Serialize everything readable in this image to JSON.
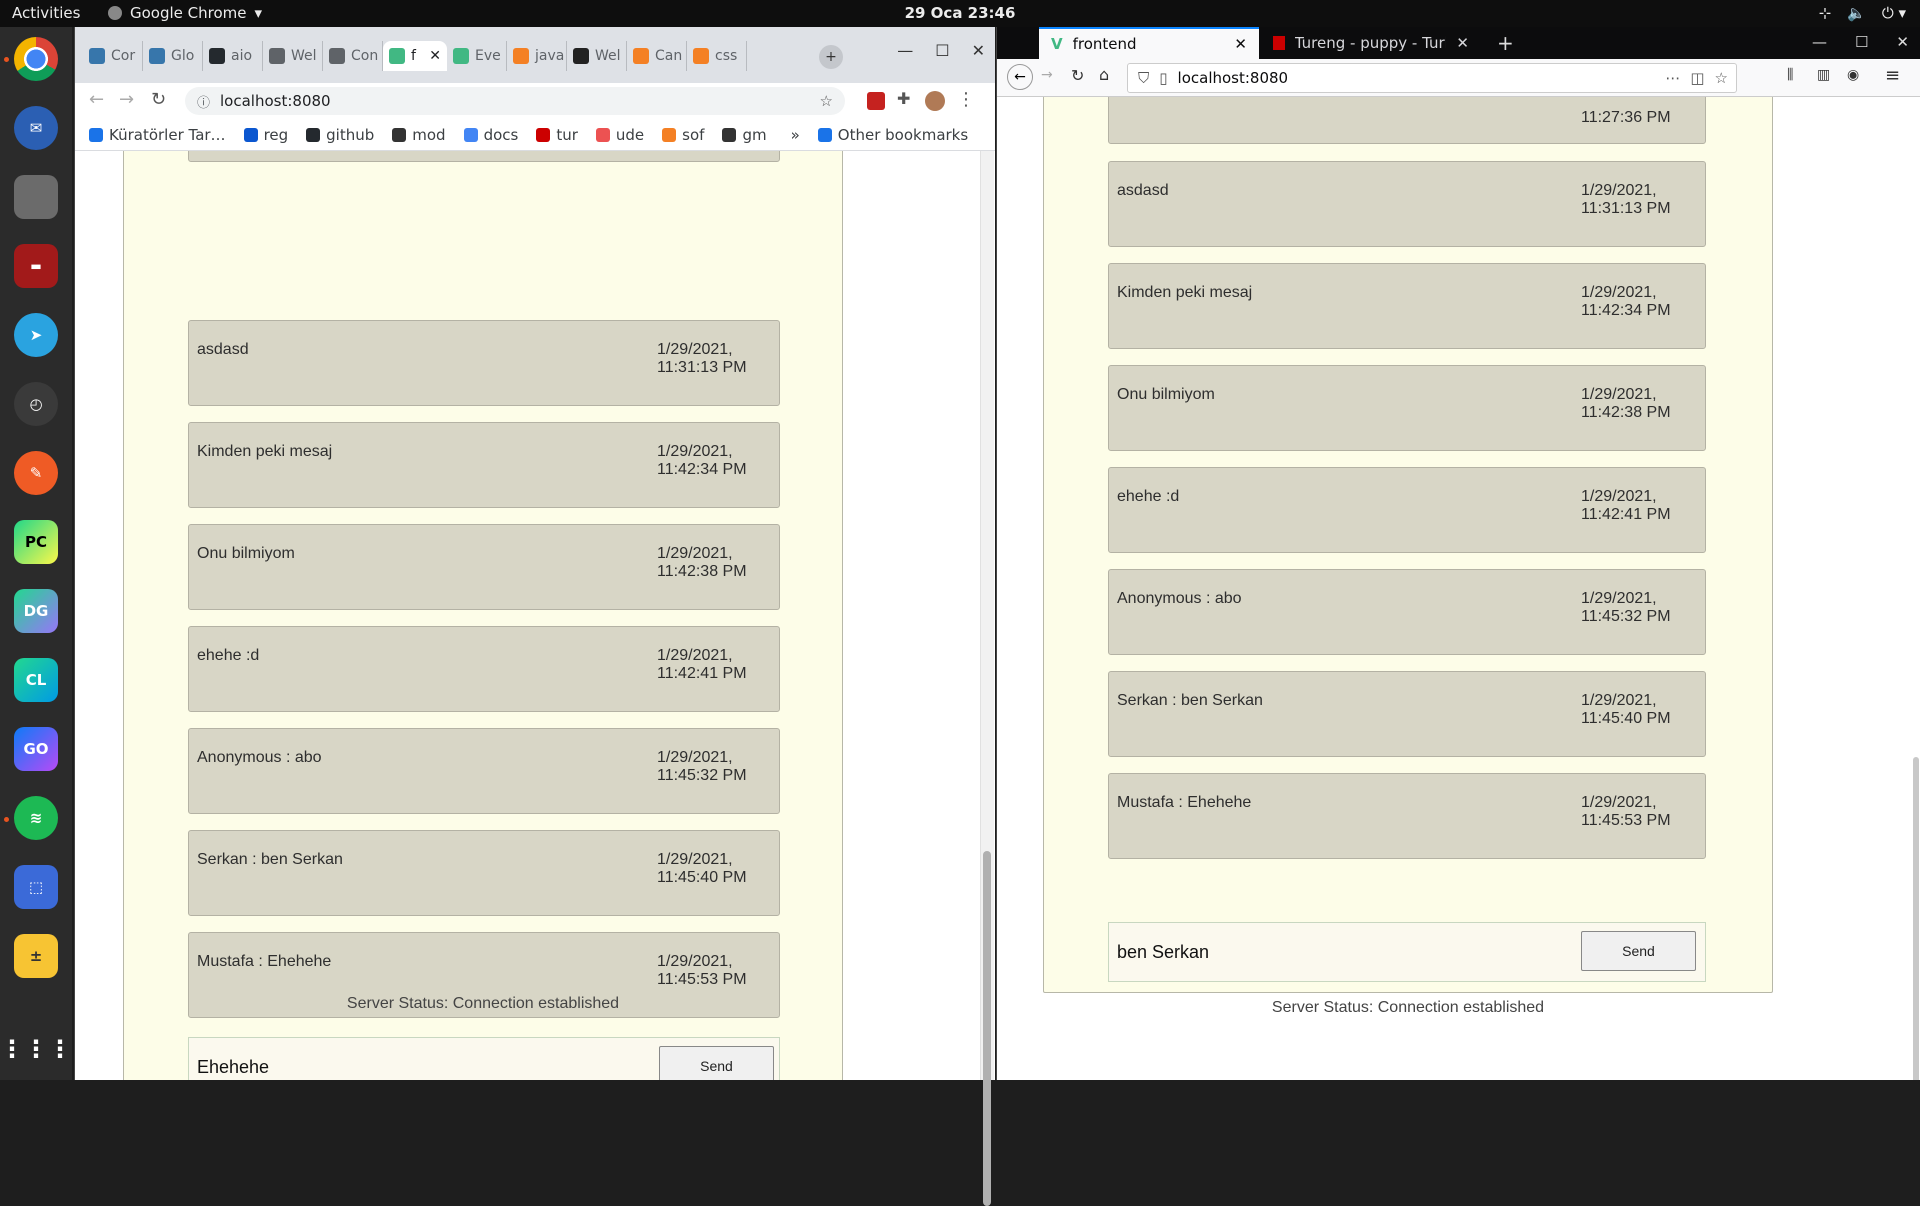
{
  "topbar": {
    "activities": "Activities",
    "app_name": "Google Chrome",
    "clock": "29 Oca  23:46"
  },
  "dock": {
    "items": [
      "chrome-icon",
      "thunderbird-icon",
      "files-icon",
      "terminal-icon",
      "telegram-icon",
      "clock-icon",
      "postman-icon",
      "PC",
      "DG",
      "CL",
      "GO",
      "spotify-icon",
      "screenshot-icon",
      "calculator-icon",
      "app-grid-icon"
    ]
  },
  "chrome": {
    "tabs": [
      {
        "label": "Cor",
        "color": "#3776ab"
      },
      {
        "label": "Glo",
        "color": "#3776ab"
      },
      {
        "label": "aio",
        "color": "#24292e"
      },
      {
        "label": "Wel",
        "color": "#5f6368"
      },
      {
        "label": "Con",
        "color": "#5f6368"
      },
      {
        "label": "f",
        "color": "#41b883"
      },
      {
        "label": "Eve",
        "color": "#41b883"
      },
      {
        "label": "java",
        "color": "#f48024"
      },
      {
        "label": "Wel",
        "color": "#222222"
      },
      {
        "label": "Can",
        "color": "#f48024"
      },
      {
        "label": "css",
        "color": "#f48024"
      }
    ],
    "url": "localhost:8080",
    "bookmarks": [
      {
        "label": "Küratörler Tar…",
        "color": "#1a73e8"
      },
      {
        "label": "reg",
        "color": "#0b57d0"
      },
      {
        "label": "github",
        "color": "#24292e"
      },
      {
        "label": "mod",
        "color": "#333333"
      },
      {
        "label": "docs",
        "color": "#4285f4"
      },
      {
        "label": "tur",
        "color": "#c00"
      },
      {
        "label": "ude",
        "color": "#ec5252"
      },
      {
        "label": "sof",
        "color": "#f48024"
      },
      {
        "label": "gm",
        "color": "#333333"
      }
    ],
    "other_bookmarks": "Other bookmarks",
    "chat_input_value": "Ehehehe"
  },
  "firefox": {
    "tab_active": "frontend",
    "tab_inactive": "Tureng - puppy - Turkish",
    "url": "localhost:8080",
    "chat_input_value": "ben Serkan",
    "first_partial_time": "11:27:36 PM"
  },
  "chat": {
    "messages": [
      {
        "text": "asdasd",
        "date": "1/29/2021,",
        "time": "11:31:13 PM"
      },
      {
        "text": "Kimden peki mesaj",
        "date": "1/29/2021,",
        "time": "11:42:34 PM"
      },
      {
        "text": "Onu bilmiyom",
        "date": "1/29/2021,",
        "time": "11:42:38 PM"
      },
      {
        "text": "ehehe :d",
        "date": "1/29/2021,",
        "time": "11:42:41 PM"
      },
      {
        "text": "Anonymous : abo",
        "date": "1/29/2021,",
        "time": "11:45:32 PM"
      },
      {
        "text": "Serkan : ben Serkan",
        "date": "1/29/2021,",
        "time": "11:45:40 PM"
      },
      {
        "text": "Mustafa : Ehehehe",
        "date": "1/29/2021,",
        "time": "11:45:53 PM"
      }
    ],
    "send_label": "Send",
    "status_label": "Server Status: Connection established"
  },
  "colors": {
    "app_bg": "#fdfde8",
    "message_bg": "#d8d6c6",
    "firefox_accent": "#0a84ff",
    "ubuntu_accent": "#e95420"
  }
}
